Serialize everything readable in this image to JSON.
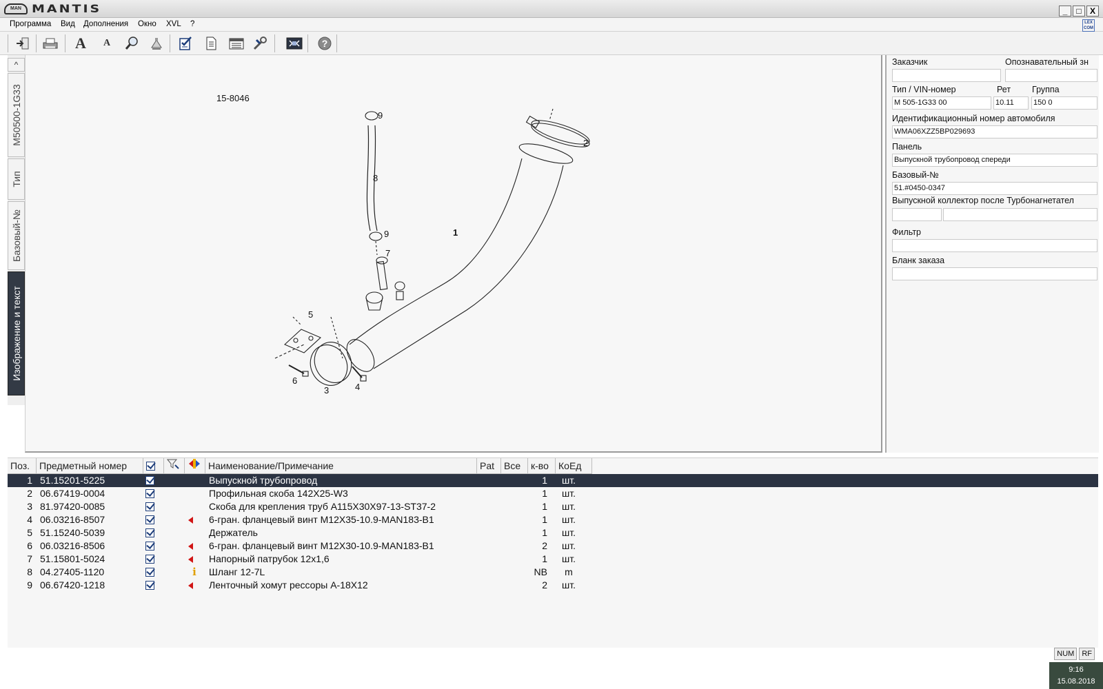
{
  "titlebar": {
    "logo_badge": "MAN",
    "app_title": "MANTIS",
    "minimize": "_",
    "maximize": "□",
    "close": "X"
  },
  "menu": {
    "items": [
      "Программа",
      "Вид",
      "Дополнения",
      "Окно",
      "XVL",
      "?"
    ],
    "lexcom": "LEX COM"
  },
  "toolbar": {
    "icons": [
      "exit-icon",
      "print-icon",
      "font-large-icon",
      "font-small-icon",
      "zoom-icon",
      "lamp-icon",
      "checklist-icon",
      "document-icon",
      "catalog-icon",
      "tools-icon",
      "fit-view-icon",
      "help-icon"
    ],
    "font_large": "A",
    "font_small": "A",
    "help": "?"
  },
  "left_tabs": {
    "scroll_up": "^",
    "tabs": [
      "M50500-1G33",
      "Тип",
      "Базовый-№",
      "Изображение и текст"
    ],
    "active": "Изображение и текст"
  },
  "drawing": {
    "id": "15-8046",
    "callouts": [
      "9",
      "8",
      "9",
      "7",
      "1",
      "2",
      "5",
      "6",
      "3",
      "4"
    ]
  },
  "info": {
    "customer_label": "Заказчик",
    "customer_value": "",
    "ident_label": "Опознавательный зн",
    "ident_value": "",
    "type_vin_label": "Тип / VIN-номер",
    "type_vin_value": "M 505-1G33 00",
    "ret_label": "Рет",
    "ret_value": "10.11",
    "group_label": "Группа",
    "group_value": "150 0",
    "vehicle_id_label": "Идентификационный номер автомобиля",
    "vehicle_id_value": "WMA06XZZ5BP029693",
    "panel_label": "Панель",
    "panel_value": "Выпускной трубопровод спереди",
    "base_no_label": "Базовый-№",
    "base_no_value": "51.#0450-0347",
    "base_desc": "Выпускной коллектор после Турбонагнетател",
    "filter_label": "Фильтр",
    "filter_value": "",
    "order_form_label": "Бланк заказа",
    "order_form_value": ""
  },
  "parts": {
    "headers": {
      "pos": "Поз.",
      "part_no": "Предметный номер",
      "name": "Наименование/Примечание",
      "pat": "Pat",
      "all": "Все",
      "qty": "к-во",
      "unit": "КоЕд"
    },
    "rows": [
      {
        "pos": "1",
        "part_no": "51.15201-5225",
        "flag": "",
        "name": "Выпускной трубопровод",
        "qty": "1",
        "unit": "шт.",
        "selected": true
      },
      {
        "pos": "2",
        "part_no": "06.67419-0004",
        "flag": "",
        "name": "Профильная скоба 142X25-W3",
        "qty": "1",
        "unit": "шт."
      },
      {
        "pos": "3",
        "part_no": "81.97420-0085",
        "flag": "",
        "name": "Скоба для крепления труб A115X30X97-13-ST37-2",
        "qty": "1",
        "unit": "шт."
      },
      {
        "pos": "4",
        "part_no": "06.03216-8507",
        "flag": "arrow",
        "name": "6-гран. фланцевый винт M12X35-10.9-MAN183-B1",
        "qty": "1",
        "unit": "шт."
      },
      {
        "pos": "5",
        "part_no": "51.15240-5039",
        "flag": "",
        "name": "Держатель",
        "qty": "1",
        "unit": "шт."
      },
      {
        "pos": "6",
        "part_no": "06.03216-8506",
        "flag": "arrow",
        "name": "6-гран. фланцевый винт M12X30-10.9-MAN183-B1",
        "qty": "2",
        "unit": "шт."
      },
      {
        "pos": "7",
        "part_no": "51.15801-5024",
        "flag": "arrow",
        "name": "Напорный патрубок 12x1,6",
        "qty": "1",
        "unit": "шт."
      },
      {
        "pos": "8",
        "part_no": "04.27405-1120",
        "flag": "info",
        "name": "Шланг 12-7L",
        "qty": "NB",
        "unit": "m"
      },
      {
        "pos": "9",
        "part_no": "06.67420-1218",
        "flag": "arrow",
        "name": "Ленточный хомут рессоры A-18X12",
        "qty": "2",
        "unit": "шт."
      }
    ]
  },
  "status": {
    "num": "NUM",
    "rf": "RF",
    "time": "9:16",
    "date": "15.08.2018"
  }
}
